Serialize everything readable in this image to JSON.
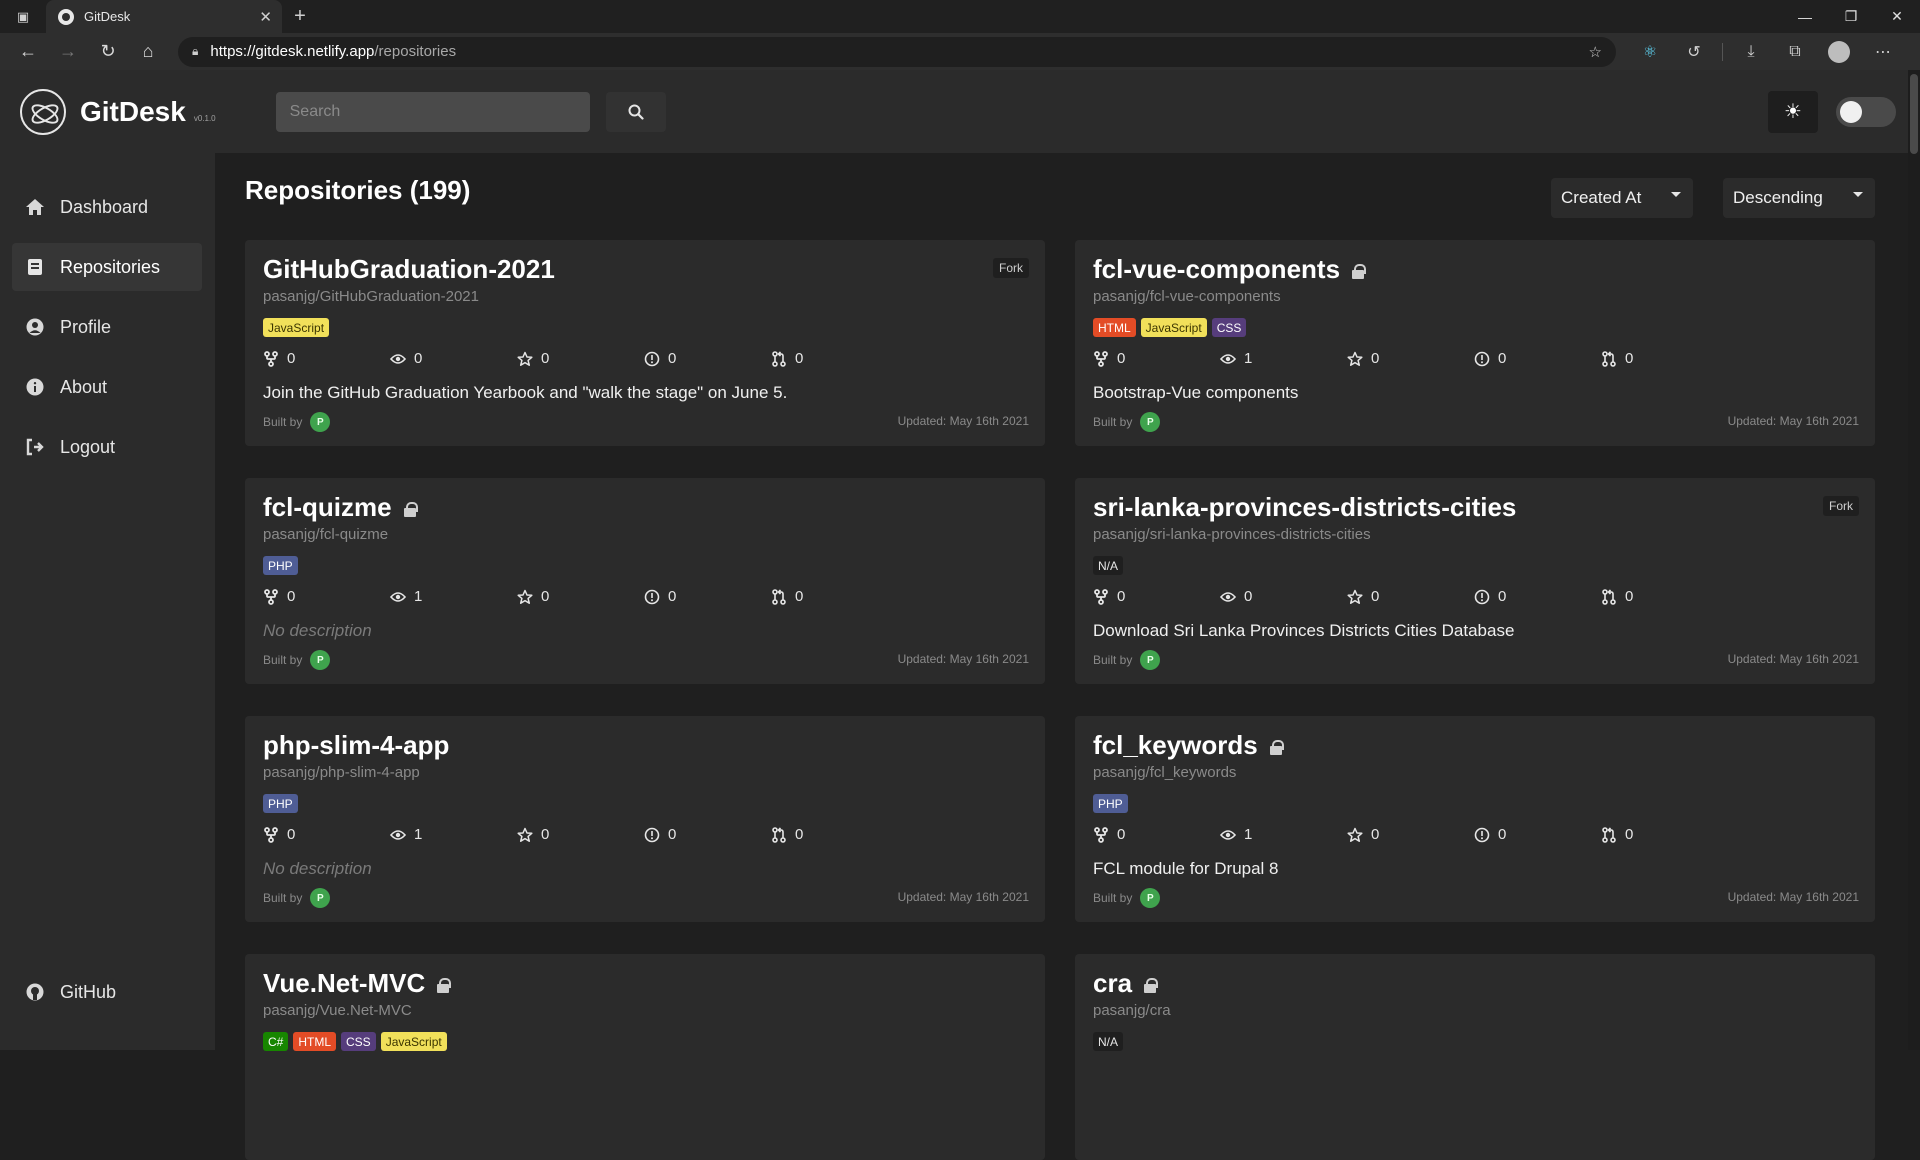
{
  "browser": {
    "tab_title": "GitDesk",
    "url_host": "https://gitdesk.netlify.app",
    "url_path": "/repositories"
  },
  "header": {
    "brand": "GitDesk",
    "version": "v0.1.0",
    "search_placeholder": "Search"
  },
  "sidebar": {
    "items": [
      {
        "label": "Dashboard",
        "icon": "home-icon"
      },
      {
        "label": "Repositories",
        "icon": "book-icon",
        "active": true
      },
      {
        "label": "Profile",
        "icon": "user-icon"
      },
      {
        "label": "About",
        "icon": "info-icon"
      },
      {
        "label": "Logout",
        "icon": "logout-icon"
      }
    ],
    "github_label": "GitHub"
  },
  "main": {
    "title": "Repositories (199)",
    "sort_field": "Created At",
    "sort_order": "Descending"
  },
  "lang_colors": {
    "JavaScript": {
      "bg": "#f1e05a",
      "fg": "#3b3500"
    },
    "HTML": {
      "bg": "#e34c26",
      "fg": "#ffffff"
    },
    "CSS": {
      "bg": "#563d7c",
      "fg": "#ffffff"
    },
    "PHP": {
      "bg": "#4f5d95",
      "fg": "#ffffff"
    },
    "C#": {
      "bg": "#178600",
      "fg": "#ffffff"
    },
    "N/A": {
      "bg": "#1f1f1f",
      "fg": "#e6e6e6"
    }
  },
  "repositories": [
    {
      "name": "GitHubGraduation-2021",
      "full_name": "pasanjg/GitHubGraduation-2021",
      "private": false,
      "fork": true,
      "fork_label": "Fork",
      "languages": [
        "JavaScript"
      ],
      "forks": "0",
      "watchers": "0",
      "stars": "0",
      "issues": "0",
      "pulls": "0",
      "description": "Join the GitHub Graduation Yearbook and \"walk the stage\" on June 5.",
      "has_description": true,
      "built_by": "Built by",
      "updated": "Updated: May 16th 2021"
    },
    {
      "name": "fcl-vue-components",
      "full_name": "pasanjg/fcl-vue-components",
      "private": true,
      "fork": false,
      "languages": [
        "HTML",
        "JavaScript",
        "CSS"
      ],
      "forks": "0",
      "watchers": "1",
      "stars": "0",
      "issues": "0",
      "pulls": "0",
      "description": "Bootstrap-Vue components",
      "has_description": true,
      "built_by": "Built by",
      "updated": "Updated: May 16th 2021"
    },
    {
      "name": "fcl-quizme",
      "full_name": "pasanjg/fcl-quizme",
      "private": true,
      "fork": false,
      "languages": [
        "PHP"
      ],
      "forks": "0",
      "watchers": "1",
      "stars": "0",
      "issues": "0",
      "pulls": "0",
      "description": "No description",
      "has_description": false,
      "built_by": "Built by",
      "updated": "Updated: May 16th 2021"
    },
    {
      "name": "sri-lanka-provinces-districts-cities",
      "full_name": "pasanjg/sri-lanka-provinces-districts-cities",
      "private": false,
      "fork": true,
      "fork_label": "Fork",
      "languages": [
        "N/A"
      ],
      "forks": "0",
      "watchers": "0",
      "stars": "0",
      "issues": "0",
      "pulls": "0",
      "description": "Download Sri Lanka Provinces Districts Cities Database",
      "has_description": true,
      "built_by": "Built by",
      "updated": "Updated: May 16th 2021"
    },
    {
      "name": "php-slim-4-app",
      "full_name": "pasanjg/php-slim-4-app",
      "private": false,
      "fork": false,
      "languages": [
        "PHP"
      ],
      "forks": "0",
      "watchers": "1",
      "stars": "0",
      "issues": "0",
      "pulls": "0",
      "description": "No description",
      "has_description": false,
      "built_by": "Built by",
      "updated": "Updated: May 16th 2021"
    },
    {
      "name": "fcl_keywords",
      "full_name": "pasanjg/fcl_keywords",
      "private": true,
      "fork": false,
      "languages": [
        "PHP"
      ],
      "forks": "0",
      "watchers": "1",
      "stars": "0",
      "issues": "0",
      "pulls": "0",
      "description": "FCL module for Drupal 8",
      "has_description": true,
      "built_by": "Built by",
      "updated": "Updated: May 16th 2021"
    },
    {
      "name": "Vue.Net-MVC",
      "full_name": "pasanjg/Vue.Net-MVC",
      "private": true,
      "fork": false,
      "languages": [
        "C#",
        "HTML",
        "CSS",
        "JavaScript"
      ]
    },
    {
      "name": "cra",
      "full_name": "pasanjg/cra",
      "private": true,
      "fork": false,
      "languages": [
        "N/A"
      ]
    }
  ]
}
